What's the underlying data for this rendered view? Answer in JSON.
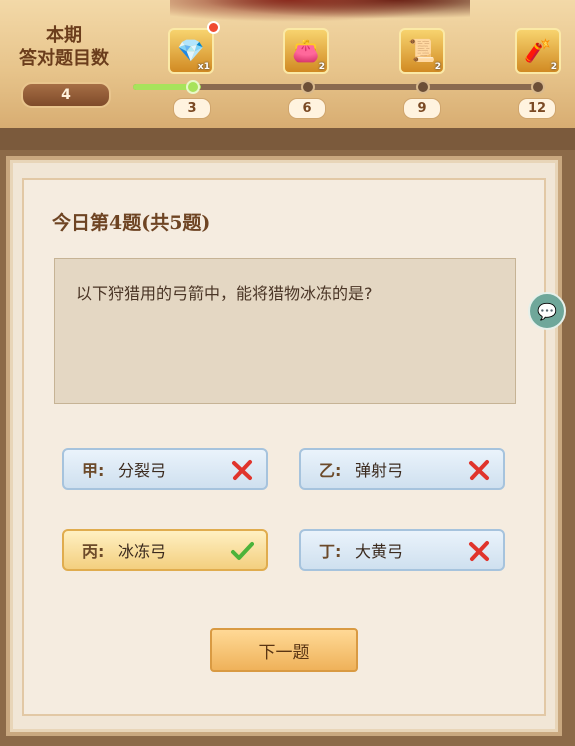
{
  "header": {
    "count_title_line1": "本期",
    "count_title_line2": "答对题目数",
    "correct_count": "4",
    "progress_fraction": 0.167,
    "milestones": [
      "3",
      "6",
      "9",
      "12"
    ],
    "rewards": [
      {
        "icon": "blue-gem-icon",
        "glyph": "💎",
        "qty": "x1"
      },
      {
        "icon": "gift-pouch-icon",
        "glyph": "👛",
        "qty": "2"
      },
      {
        "icon": "scroll-icon",
        "glyph": "📜",
        "qty": "2"
      },
      {
        "icon": "firecracker-icon",
        "glyph": "🧨",
        "qty": "2"
      }
    ]
  },
  "quiz": {
    "heading": "今日第4题(共5题)",
    "question": "以下狩猎用的弓箭中，能将猎物冰冻的是?",
    "options": [
      {
        "key": "甲:",
        "text": "分裂弓",
        "result": "wrong"
      },
      {
        "key": "乙:",
        "text": "弹射弓",
        "result": "wrong"
      },
      {
        "key": "丙:",
        "text": "冰冻弓",
        "result": "correct"
      },
      {
        "key": "丁:",
        "text": "大黄弓",
        "result": "wrong"
      }
    ],
    "next_label": "下一题"
  },
  "colors": {
    "correct": "#4cb33a",
    "wrong": "#e0342c",
    "accent": "#f3cf7f"
  }
}
